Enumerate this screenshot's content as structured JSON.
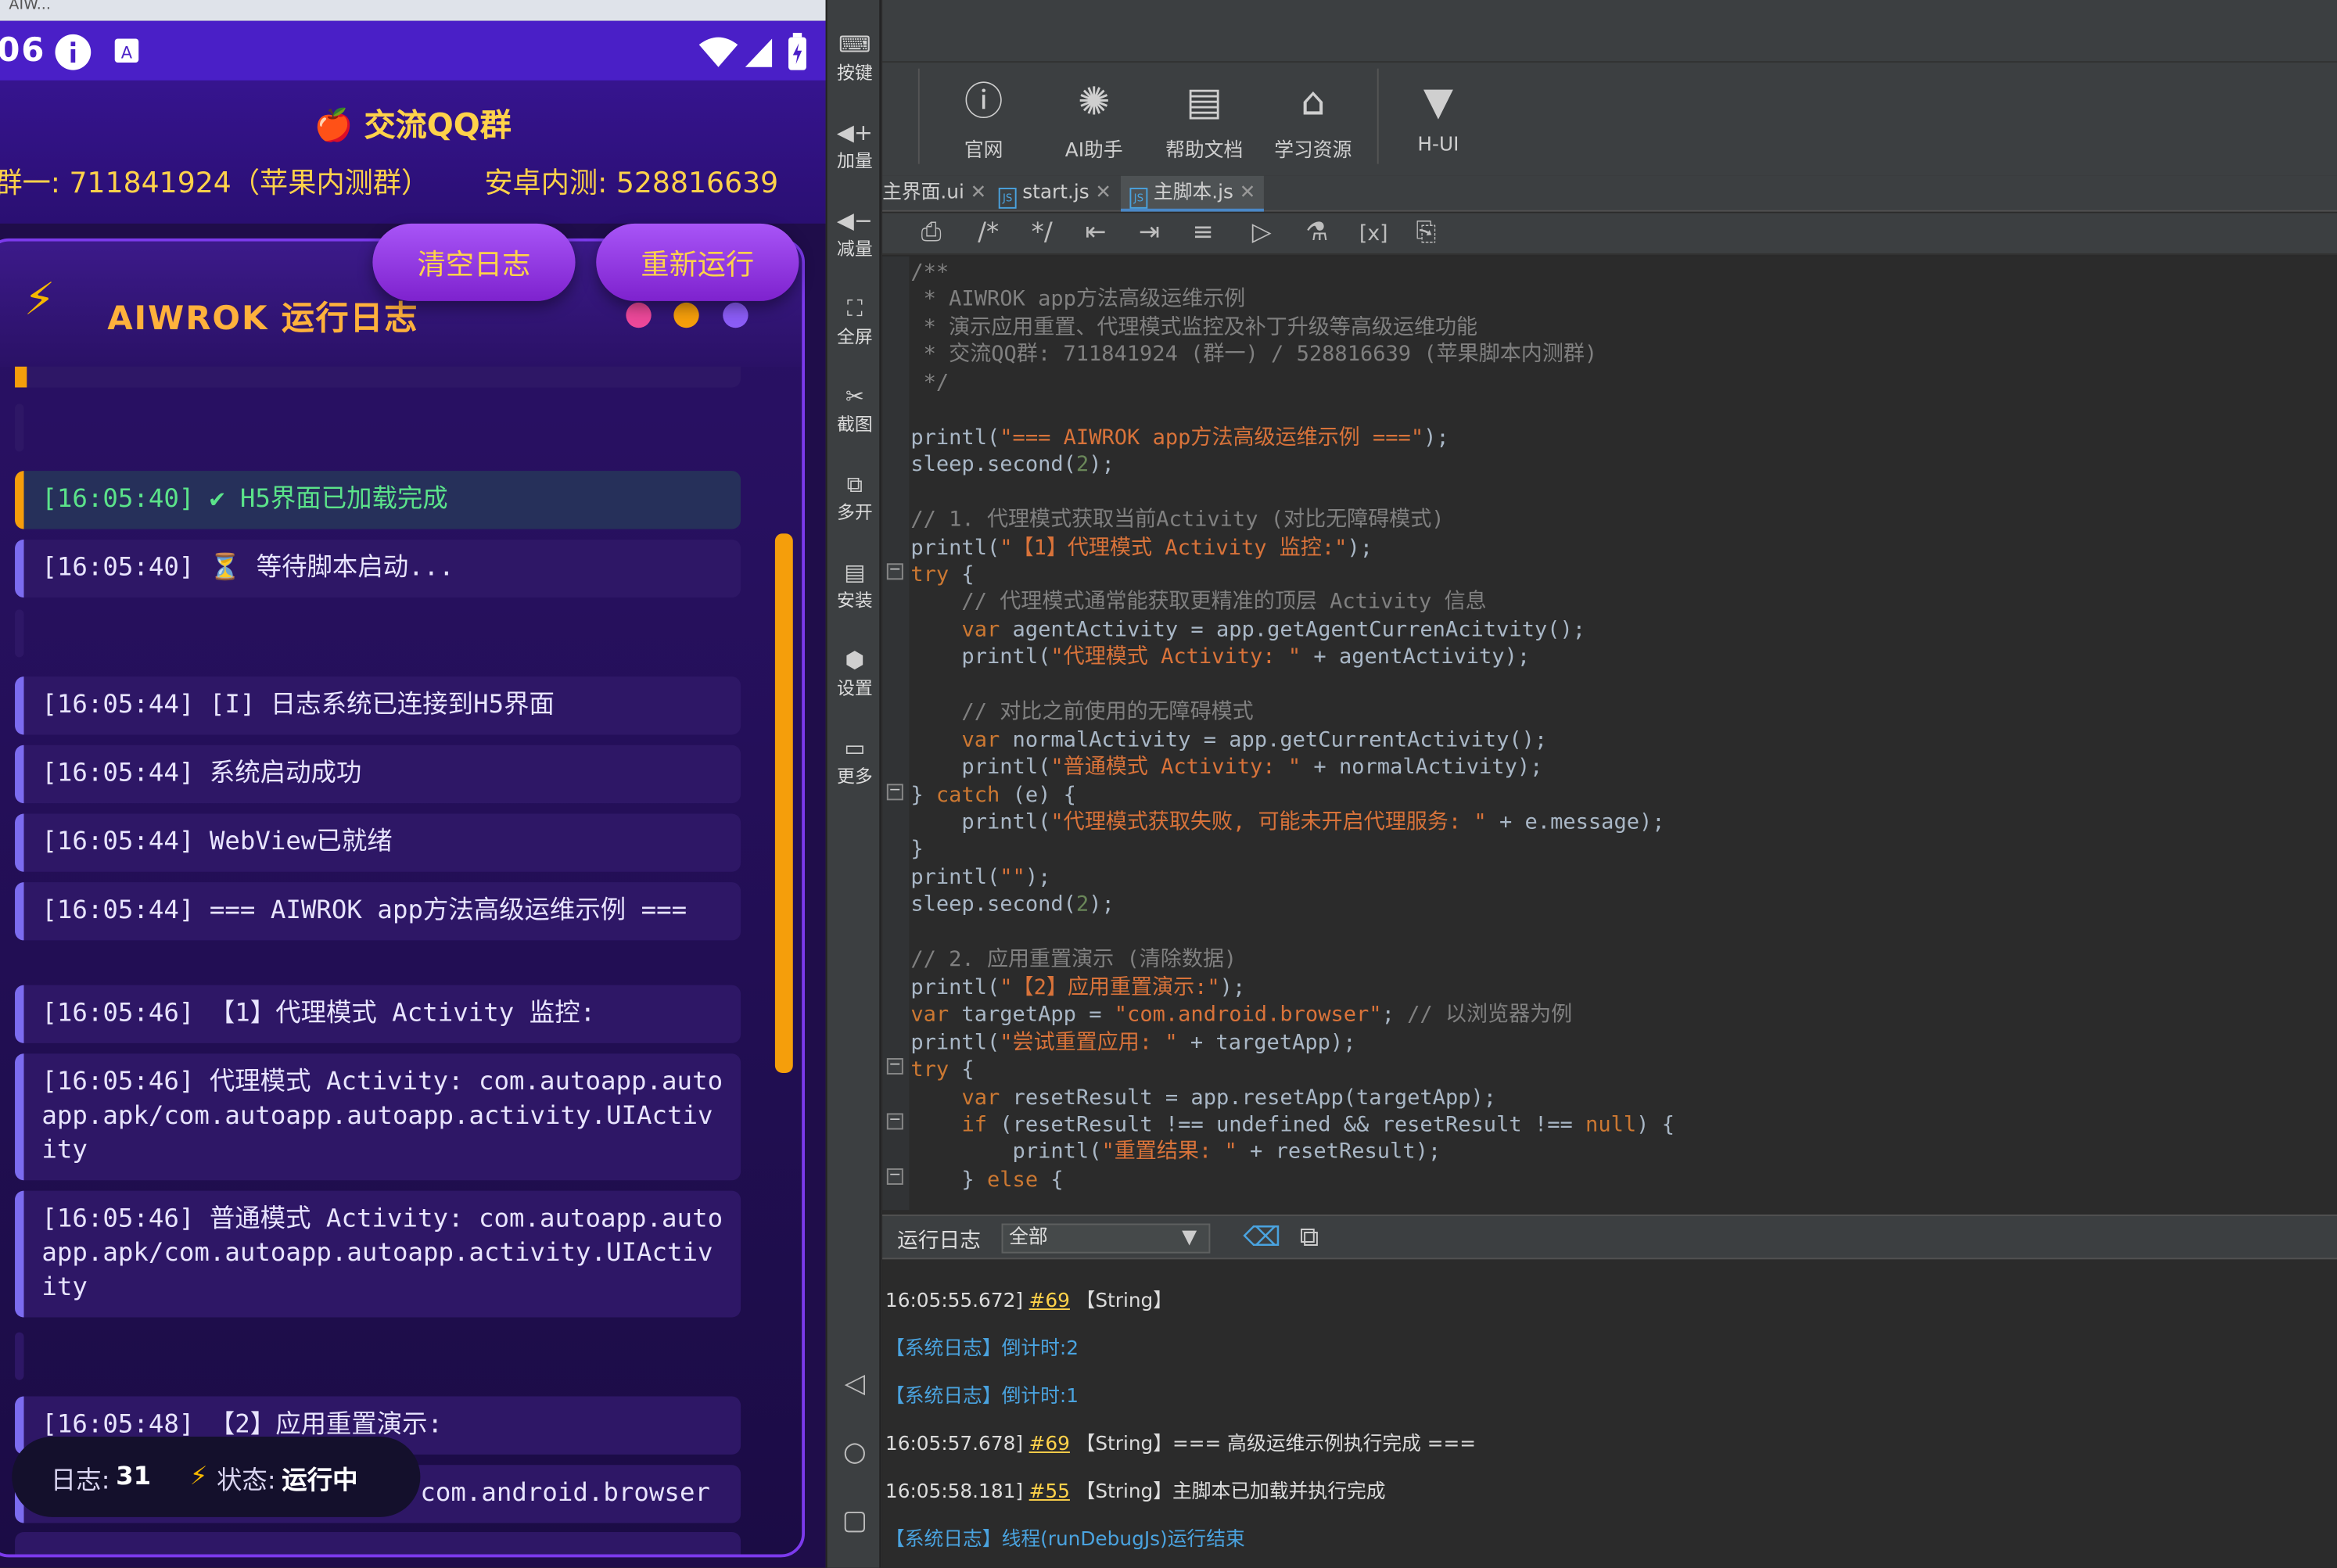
{
  "phone": {
    "top_chrome": [
      "AIW..."
    ],
    "status_time": "06",
    "header": {
      "title": "🍎 交流QQ群",
      "group1": "群一: 711841924（苹果内测群）",
      "group2": "安卓内测: 528816639"
    },
    "buttons": {
      "clear": "清空日志",
      "rerun": "重新运行"
    },
    "panel_title": "AIWROK 运行日志",
    "logs": [
      {
        "text": "[16:05:40] ✔ H5界面已加载完成",
        "ok": true
      },
      {
        "text": "[16:05:40] ⏳ 等待脚本启动..."
      },
      {
        "text": "[16:05:44] [I] 日志系统已连接到H5界面"
      },
      {
        "text": "[16:05:44] 系统启动成功"
      },
      {
        "text": "[16:05:44] WebView已就绪"
      },
      {
        "text": "[16:05:44] === AIWROK app方法高级运维示例 ==="
      },
      {
        "text": "[16:05:46] 【1】代理模式 Activity 监控:"
      },
      {
        "text": "[16:05:46] 代理模式 Activity: com.autoapp.autoapp.apk/com.autoapp.autoapp.activity.UIActivity"
      },
      {
        "text": "[16:05:46] 普通模式 Activity: com.autoapp.autoapp.apk/com.autoapp.autoapp.activity.UIActivity"
      },
      {
        "text": "[16:05:48] 【2】应用重置演示:"
      },
      {
        "text": "com.android.browser"
      }
    ],
    "status": {
      "log_label": "日志:",
      "log_count": "31",
      "state_label": "状态:",
      "state_value": "运行中"
    }
  },
  "emulator_sidebar": [
    {
      "icon": "keyboard-icon",
      "label": "按键"
    },
    {
      "icon": "volume-up-icon",
      "label": "加量"
    },
    {
      "icon": "volume-down-icon",
      "label": "减量"
    },
    {
      "icon": "fullscreen-icon",
      "label": "全屏"
    },
    {
      "icon": "scissors-icon",
      "label": "截图"
    },
    {
      "icon": "multi-window-icon",
      "label": "多开"
    },
    {
      "icon": "apk-icon",
      "label": "安装"
    },
    {
      "icon": "settings-icon",
      "label": "设置"
    },
    {
      "icon": "more-icon",
      "label": "更多"
    }
  ],
  "ide": {
    "toolbar": [
      {
        "icon": "help-icon",
        "label": "官网"
      },
      {
        "icon": "ai-icon",
        "label": "AI助手"
      },
      {
        "icon": "doc-icon",
        "label": "帮助文档"
      },
      {
        "icon": "graduation-icon",
        "label": "学习资源"
      },
      {
        "icon": "vue-icon",
        "label": "H-UI"
      }
    ],
    "tabs": [
      {
        "label": "主界面.ui"
      },
      {
        "label": "start.js"
      },
      {
        "label": "主脚本.js",
        "active": true
      }
    ],
    "code_lines": [
      [
        {
          "t": "/**",
          "c": "com"
        }
      ],
      [
        {
          "t": " * AIWROK app方法高级运维示例",
          "c": "com"
        }
      ],
      [
        {
          "t": " * 演示应用重置、代理模式监控及补丁升级等高级运维功能",
          "c": "com"
        }
      ],
      [
        {
          "t": " * 交流QQ群: 711841924 (群一) / 528816639 (苹果脚本内测群)",
          "c": "com"
        }
      ],
      [
        {
          "t": " */",
          "c": "com"
        }
      ],
      [],
      [
        {
          "t": "printl("
        },
        {
          "t": "\"=== AIWROK app方法高级运维示例 ===\"",
          "c": "str"
        },
        {
          "t": ");"
        }
      ],
      [
        {
          "t": "sleep.second("
        },
        {
          "t": "2",
          "c": "num"
        },
        {
          "t": ");"
        }
      ],
      [],
      [
        {
          "t": "// 1. 代理模式获取当前Activity (对比无障碍模式)",
          "c": "com"
        }
      ],
      [
        {
          "t": "printl("
        },
        {
          "t": "\"【1】代理模式 Activity 监控:\"",
          "c": "str"
        },
        {
          "t": ");"
        }
      ],
      [
        {
          "t": "try",
          "c": "kw"
        },
        {
          "t": " {"
        }
      ],
      [
        {
          "t": "    // 代理模式通常能获取更精准的顶层 Activity 信息",
          "c": "com"
        }
      ],
      [
        {
          "t": "    "
        },
        {
          "t": "var",
          "c": "kw"
        },
        {
          "t": " agentActivity = app.getAgentCurrenAcitvity();"
        }
      ],
      [
        {
          "t": "    printl("
        },
        {
          "t": "\"代理模式 Activity: \"",
          "c": "str"
        },
        {
          "t": " + agentActivity);"
        }
      ],
      [],
      [
        {
          "t": "    // 对比之前使用的无障碍模式",
          "c": "com"
        }
      ],
      [
        {
          "t": "    "
        },
        {
          "t": "var",
          "c": "kw"
        },
        {
          "t": " normalActivity = app.getCurrentActivity();"
        }
      ],
      [
        {
          "t": "    printl("
        },
        {
          "t": "\"普通模式 Activity: \"",
          "c": "str"
        },
        {
          "t": " + normalActivity);"
        }
      ],
      [
        {
          "t": "} "
        },
        {
          "t": "catch",
          "c": "kw"
        },
        {
          "t": " (e) {"
        }
      ],
      [
        {
          "t": "    printl("
        },
        {
          "t": "\"代理模式获取失败, 可能未开启代理服务: \"",
          "c": "str"
        },
        {
          "t": " + e.message);"
        }
      ],
      [
        {
          "t": "}"
        }
      ],
      [
        {
          "t": "printl("
        },
        {
          "t": "\"\"",
          "c": "str"
        },
        {
          "t": ");"
        }
      ],
      [
        {
          "t": "sleep.second("
        },
        {
          "t": "2",
          "c": "num"
        },
        {
          "t": ");"
        }
      ],
      [],
      [
        {
          "t": "// 2. 应用重置演示 (清除数据)",
          "c": "com"
        }
      ],
      [
        {
          "t": "printl("
        },
        {
          "t": "\"【2】应用重置演示:\"",
          "c": "str"
        },
        {
          "t": ");"
        }
      ],
      [
        {
          "t": "var",
          "c": "kw"
        },
        {
          "t": " targetApp = "
        },
        {
          "t": "\"com.android.browser\"",
          "c": "str"
        },
        {
          "t": "; "
        },
        {
          "t": "// 以浏览器为例",
          "c": "com"
        }
      ],
      [
        {
          "t": "printl("
        },
        {
          "t": "\"尝试重置应用: \"",
          "c": "str"
        },
        {
          "t": " + targetApp);"
        }
      ],
      [
        {
          "t": "try",
          "c": "kw"
        },
        {
          "t": " {"
        }
      ],
      [
        {
          "t": "    "
        },
        {
          "t": "var",
          "c": "kw"
        },
        {
          "t": " resetResult = app.resetApp(targetApp);"
        }
      ],
      [
        {
          "t": "    "
        },
        {
          "t": "if",
          "c": "kw"
        },
        {
          "t": " (resetResult !== undefined && resetResult !== "
        },
        {
          "t": "null",
          "c": "kw"
        },
        {
          "t": ") {"
        }
      ],
      [
        {
          "t": "        printl("
        },
        {
          "t": "\"重置结果: \"",
          "c": "str"
        },
        {
          "t": " + resetResult);"
        }
      ],
      [
        {
          "t": "    } "
        },
        {
          "t": "else",
          "c": "kw"
        },
        {
          "t": " {"
        }
      ]
    ],
    "run_panel": {
      "label": "运行日志",
      "filter": "全部"
    },
    "console": [
      {
        "pre": "16:05:55.672]",
        "num": "#69",
        "text": "【String】"
      },
      {
        "text": "【系统日志】倒计时:2",
        "sys": true
      },
      {
        "text": "【系统日志】倒计时:1",
        "sys": true
      },
      {
        "pre": "16:05:57.678]",
        "num": "#69",
        "text": "【String】=== 高级运维示例执行完成 ==="
      },
      {
        "pre": "16:05:58.181]",
        "num": "#55",
        "text": "【String】主脚本已加载并执行完成"
      },
      {
        "text": "【系统日志】线程(runDebugJs)运行结束",
        "sys": true
      }
    ]
  },
  "colors": {
    "accent_purple": "#7c3aed",
    "gold": "#ffd24a",
    "orange": "#f59e0b",
    "ide_bg": "#2b2b2b"
  }
}
